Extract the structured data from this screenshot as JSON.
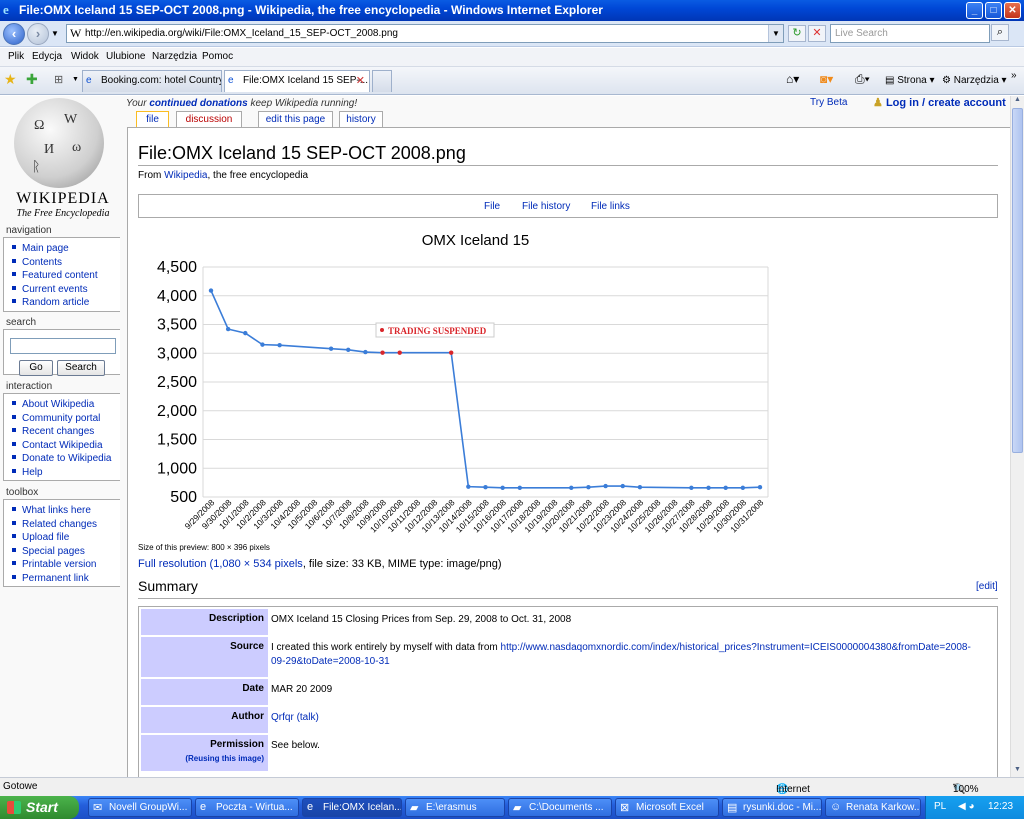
{
  "window": {
    "title": "File:OMX Iceland 15 SEP-OCT 2008.png - Wikipedia, the free encyclopedia - Windows Internet Explorer"
  },
  "address_bar": {
    "url": "http://en.wikipedia.org/wiki/File:OMX_Iceland_15_SEP-OCT_2008.png",
    "search_placeholder": "Live Search"
  },
  "menu": [
    "Plik",
    "Edycja",
    "Widok",
    "Ulubione",
    "Narzędzia",
    "Pomoc"
  ],
  "tabs": [
    {
      "label": "Booking.com: hotel Country ..."
    },
    {
      "label": "File:OMX Iceland 15 SEP-..."
    }
  ],
  "toolbar": {
    "page_label": "Strona",
    "tools_label": "Narzędzia"
  },
  "wiki": {
    "logo_name": "WIKIPEDIA",
    "logo_tagline": "The Free Encyclopedia",
    "donate_pre": "Your",
    "donate_link": "continued donations",
    "donate_post": "keep Wikipedia running!",
    "try_beta": "Try Beta",
    "login": "Log in / create account",
    "page_tabs": [
      "file",
      "discussion",
      "edit this page",
      "history"
    ],
    "navigation_title": "navigation",
    "navigation": [
      "Main page",
      "Contents",
      "Featured content",
      "Current events",
      "Random article"
    ],
    "search_title": "search",
    "go_button": "Go",
    "search_button": "Search",
    "interaction_title": "interaction",
    "interaction": [
      "About Wikipedia",
      "Community portal",
      "Recent changes",
      "Contact Wikipedia",
      "Donate to Wikipedia",
      "Help"
    ],
    "toolbox_title": "toolbox",
    "toolbox": [
      "What links here",
      "Related changes",
      "Upload file",
      "Special pages",
      "Printable version",
      "Permanent link"
    ]
  },
  "article": {
    "title": "File:OMX Iceland 15 SEP-OCT 2008.png",
    "from_pre": "From",
    "from_link": "Wikipedia",
    "from_post": ", the free encyclopedia",
    "file_toc": [
      "File",
      "File history",
      "File links"
    ],
    "preview_size": "Size of this preview: 800 × 396 pixels",
    "full_res_link": "Full resolution",
    "full_res_dims": " (1,080 × 534 pixels",
    "full_res_rest": ", file size: 33 KB, MIME type: image/png)",
    "summary_heading": "Summary",
    "summary_edit": "[edit]",
    "info": {
      "description_label": "Description",
      "description": "OMX Iceland 15 Closing Prices from Sep. 29, 2008 to Oct. 31, 2008",
      "source_label": "Source",
      "source_text": "I created this work entirely by myself with data from ",
      "source_link": "http://www.nasdaqomxnordic.com/index/historical_prices?Instrument=ICEIS0000004380&fromDate=2008-09-29&toDate=2008-10-31",
      "date_label": "Date",
      "date": "MAR 20 2009",
      "author_label": "Author",
      "author": "Qrfqr",
      "author_talk": "(talk)",
      "permission_label": "Permission",
      "permission_sub": "(Reusing this image)",
      "permission": "See below."
    }
  },
  "chart_data": {
    "type": "line",
    "title": "OMX Iceland 15",
    "ylim": [
      500,
      4500
    ],
    "yticks": [
      "4,500",
      "4,000",
      "3,500",
      "3,000",
      "2,500",
      "2,000",
      "1,500",
      "1,000",
      "500"
    ],
    "ytick_values": [
      4500,
      4000,
      3500,
      3000,
      2500,
      2000,
      1500,
      1000,
      500
    ],
    "grid": true,
    "categories": [
      "9/29/2008",
      "9/30/2008",
      "10/1/2008",
      "10/2/2008",
      "10/3/2008",
      "10/4/2008",
      "10/5/2008",
      "10/6/2008",
      "10/7/2008",
      "10/8/2008",
      "10/9/2008",
      "10/10/2008",
      "10/11/2008",
      "10/12/2008",
      "10/13/2008",
      "10/14/2008",
      "10/15/2008",
      "10/16/2008",
      "10/17/2008",
      "10/18/2008",
      "10/19/2008",
      "10/20/2008",
      "10/21/2008",
      "10/22/2008",
      "10/23/2008",
      "10/24/2008",
      "10/25/2008",
      "10/26/2008",
      "10/27/2008",
      "10/28/2008",
      "10/29/2008",
      "10/30/2008",
      "10/31/2008"
    ],
    "values": [
      4090,
      3420,
      3350,
      3150,
      3140,
      null,
      null,
      3080,
      3060,
      3020,
      3010,
      3010,
      null,
      null,
      3010,
      680,
      670,
      660,
      660,
      null,
      null,
      660,
      670,
      690,
      690,
      670,
      null,
      null,
      660,
      660,
      660,
      660,
      670
    ],
    "suspended_indices": [
      10,
      11,
      14
    ],
    "annotation": "TRADING SUSPENDED",
    "colors": {
      "line": "#3b7dd8",
      "suspended": "#d9262b",
      "grid": "#d9d9d9"
    }
  },
  "status": {
    "left": "Gotowe",
    "zone": "Internet",
    "zoom": "100%"
  },
  "taskbar": {
    "start": "Start",
    "tasks": [
      "Novell GroupWi...",
      "Poczta - Wirtua...",
      "File:OMX Icelan...",
      "E:\\erasmus",
      "C:\\Documents ...",
      "Microsoft Excel",
      "rysunki.doc - Mi...",
      "Renata Karkow..."
    ],
    "lang": "PL",
    "time": "12:23"
  }
}
